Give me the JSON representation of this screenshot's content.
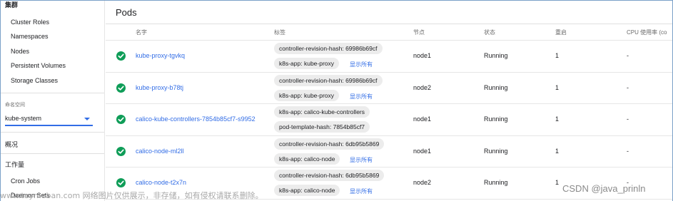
{
  "sidebar": {
    "cluster_title": "集群",
    "cluster_items": [
      "Cluster Roles",
      "Namespaces",
      "Nodes",
      "Persistent Volumes",
      "Storage Classes"
    ],
    "namespace_label": "命名空间",
    "namespace_value": "kube-system",
    "overview": "概况",
    "workloads": "工作量",
    "workload_items": [
      "Cron Jobs",
      "Daemon Sets"
    ]
  },
  "main": {
    "title": "Pods",
    "columns": {
      "name": "名字",
      "labels": "标签",
      "node": "节点",
      "status": "状态",
      "restarts": "重启",
      "cpu": "CPU 使用率 (co"
    },
    "show_all": "显示所有",
    "rows": [
      {
        "name": "kube-proxy-tgvkq",
        "labels": [
          "controller-revision-hash: 69986b69cf",
          "k8s-app: kube-proxy"
        ],
        "node": "node1",
        "status": "Running",
        "restarts": "1",
        "cpu": "-"
      },
      {
        "name": "kube-proxy-b78tj",
        "labels": [
          "controller-revision-hash: 69986b69cf",
          "k8s-app: kube-proxy"
        ],
        "node": "node2",
        "status": "Running",
        "restarts": "1",
        "cpu": "-"
      },
      {
        "name": "calico-kube-controllers-7854b85cf7-s9952",
        "labels": [
          "k8s-app: calico-kube-controllers",
          "pod-template-hash: 7854b85cf7"
        ],
        "node": "node1",
        "status": "Running",
        "restarts": "1",
        "cpu": "-"
      },
      {
        "name": "calico-node-ml2ll",
        "labels": [
          "controller-revision-hash: 6db95b5869",
          "k8s-app: calico-node"
        ],
        "node": "node1",
        "status": "Running",
        "restarts": "1",
        "cpu": "-"
      },
      {
        "name": "calico-node-t2x7n",
        "labels": [
          "controller-revision-hash: 6db95b5869",
          "k8s-app: calico-node"
        ],
        "node": "node2",
        "status": "Running",
        "restarts": "1",
        "cpu": "-"
      }
    ]
  },
  "watermark": "www.toymoban.com 网络图片仅供展示，非存储，如有侵权请联系删除。",
  "csdn_mark": "CSDN @java_prinln",
  "colors": {
    "accent": "#326de6",
    "success": "#0f9d58",
    "chip": "#ececec"
  },
  "icons": {
    "status": "check-circle-icon",
    "dropdown": "chevron-down-icon"
  }
}
